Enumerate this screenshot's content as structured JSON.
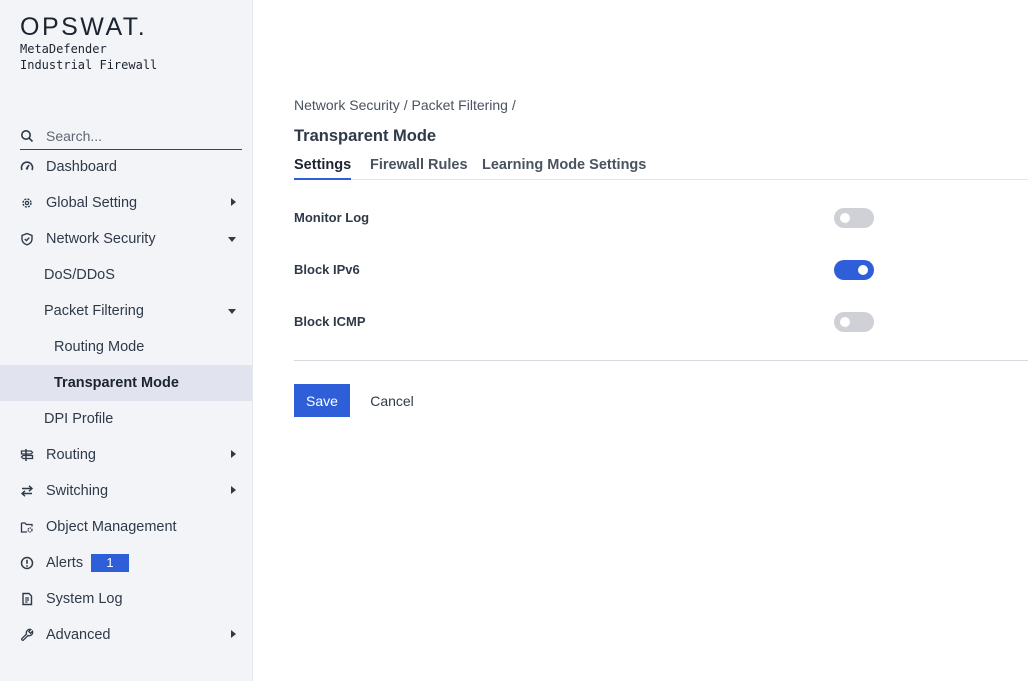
{
  "brand": {
    "logo": "OPSWAT.",
    "product_line1": "MetaDefender",
    "product_line2": "Industrial Firewall"
  },
  "search": {
    "placeholder": "Search..."
  },
  "sidebar": {
    "items": [
      {
        "label": "Dashboard",
        "icon": "dashboard-icon"
      },
      {
        "label": "Global Setting",
        "icon": "gear-icon"
      },
      {
        "label": "Network Security",
        "icon": "shield-icon"
      },
      {
        "label": "DoS/DDoS"
      },
      {
        "label": "Packet Filtering"
      },
      {
        "label": "Routing Mode"
      },
      {
        "label": "Transparent Mode"
      },
      {
        "label": "DPI Profile"
      },
      {
        "label": "Routing",
        "icon": "signpost-icon"
      },
      {
        "label": "Switching",
        "icon": "switch-arrows-icon"
      },
      {
        "label": "Object Management",
        "icon": "folder-gear-icon"
      },
      {
        "label": "Alerts",
        "icon": "alert-circle-icon",
        "badge": "1"
      },
      {
        "label": "System Log",
        "icon": "log-file-icon"
      },
      {
        "label": "Advanced",
        "icon": "wrench-icon"
      }
    ]
  },
  "main": {
    "breadcrumb": "Network Security / Packet Filtering /",
    "title": "Transparent Mode",
    "tabs": [
      {
        "label": "Settings",
        "active": true
      },
      {
        "label": "Firewall Rules",
        "active": false
      },
      {
        "label": "Learning Mode Settings",
        "active": false
      }
    ],
    "settings": [
      {
        "label": "Monitor Log",
        "enabled": false
      },
      {
        "label": "Block IPv6",
        "enabled": true
      },
      {
        "label": "Block ICMP",
        "enabled": false
      }
    ],
    "save_label": "Save",
    "cancel_label": "Cancel"
  },
  "colors": {
    "accent": "#2f5fd8",
    "sidebar_bg": "#f3f4f8",
    "active_bg": "#e1e4ef"
  }
}
